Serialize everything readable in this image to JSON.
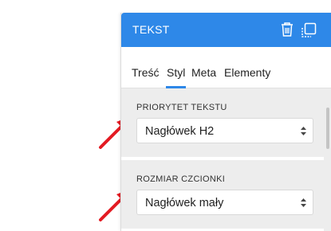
{
  "panel": {
    "title": "TEKST",
    "tabs": [
      {
        "label": "Treść"
      },
      {
        "label": "Styl"
      },
      {
        "label": "Meta"
      },
      {
        "label": "Elementy"
      }
    ],
    "active_tab": "Styl",
    "fields": [
      {
        "label": "PRIORYTET TEKSTU",
        "value": "Nagłówek H2"
      },
      {
        "label": "ROZMIAR CZCIONKI",
        "value": "Nagłówek mały"
      }
    ]
  },
  "icons": {
    "header": [
      "trash-icon",
      "copy-icon"
    ],
    "select": "updown-chevron-icon",
    "annotation": "red-arrow-icon"
  },
  "colors": {
    "accent": "#2e88e8",
    "annotation": "#e31b23",
    "panel_bg": "#ededed"
  }
}
